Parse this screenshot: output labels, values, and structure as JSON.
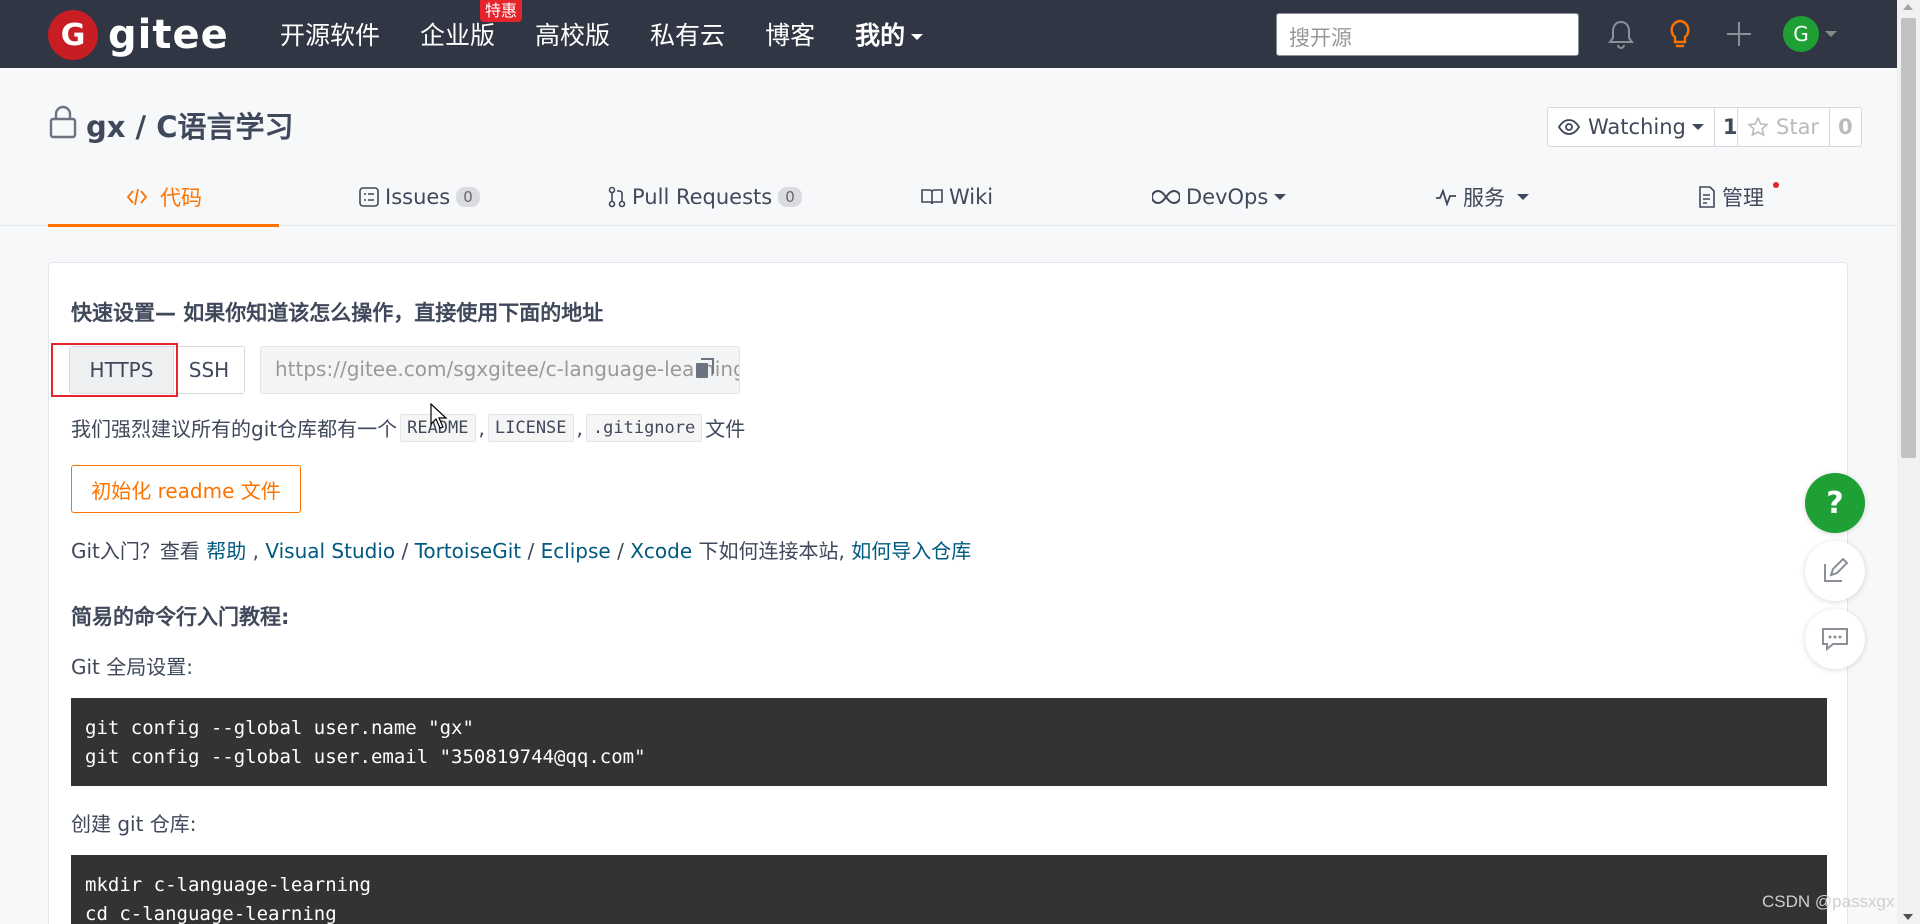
{
  "brand": {
    "logo_letter": "G",
    "name": "gitee",
    "color": "#c71d23"
  },
  "nav": {
    "items": [
      {
        "label": "开源软件"
      },
      {
        "label": "企业版",
        "badge": "特惠"
      },
      {
        "label": "高校版"
      },
      {
        "label": "私有云"
      },
      {
        "label": "博客"
      },
      {
        "label": "我的"
      }
    ],
    "search_placeholder": "搜开源",
    "icons": [
      "bell-icon",
      "bulb-icon",
      "plus-icon"
    ],
    "avatar_letter": "G"
  },
  "repo": {
    "title": "gx / C语言学习",
    "watch_label": "Watching",
    "watch_count": "1",
    "star_label": "Star",
    "star_count": "0"
  },
  "tabs": [
    {
      "label": "代码",
      "active": true
    },
    {
      "label": "Issues",
      "count": "0"
    },
    {
      "label": "Pull Requests",
      "count": "0"
    },
    {
      "label": "Wiki"
    },
    {
      "label": "DevOps"
    },
    {
      "label": "服务"
    },
    {
      "label": "管理"
    }
  ],
  "quick_setup": {
    "title": "快速设置— 如果你知道该怎么操作，直接使用下面的地址",
    "https_label": "HTTPS",
    "ssh_label": "SSH",
    "url": "https://gitee.com/sgxgitee/c-language-learning.git",
    "recommend_prefix": "我们强烈建议所有的git仓库都有一个",
    "chips": [
      "README",
      "LICENSE",
      ".gitignore"
    ],
    "sep": ",",
    "recommend_suffix": "文件",
    "init_button": "初始化 readme 文件",
    "intro_prefix": "Git入门？查看 ",
    "intro_help": "帮助",
    "intro_sep1": " , ",
    "intro_vs": "Visual Studio",
    "intro_slash": " / ",
    "intro_tortoise": "TortoiseGit",
    "intro_eclipse": "Eclipse",
    "intro_xcode": "Xcode",
    "intro_mid": " 下如何连接本站, ",
    "intro_import": "如何导入仓库"
  },
  "tutorial": {
    "title": "简易的命令行入门教程:",
    "global_label": "Git 全局设置:",
    "global_lines": [
      "git config --global user.name \"gx\"",
      "git config --global user.email \"350819744@qq.com\""
    ],
    "create_label": "创建 git 仓库:",
    "create_lines": [
      "mkdir c-language-learning",
      "cd c-language-learning"
    ]
  },
  "fabs": {
    "help_label": "?"
  },
  "watermark": "CSDN @passxgx"
}
